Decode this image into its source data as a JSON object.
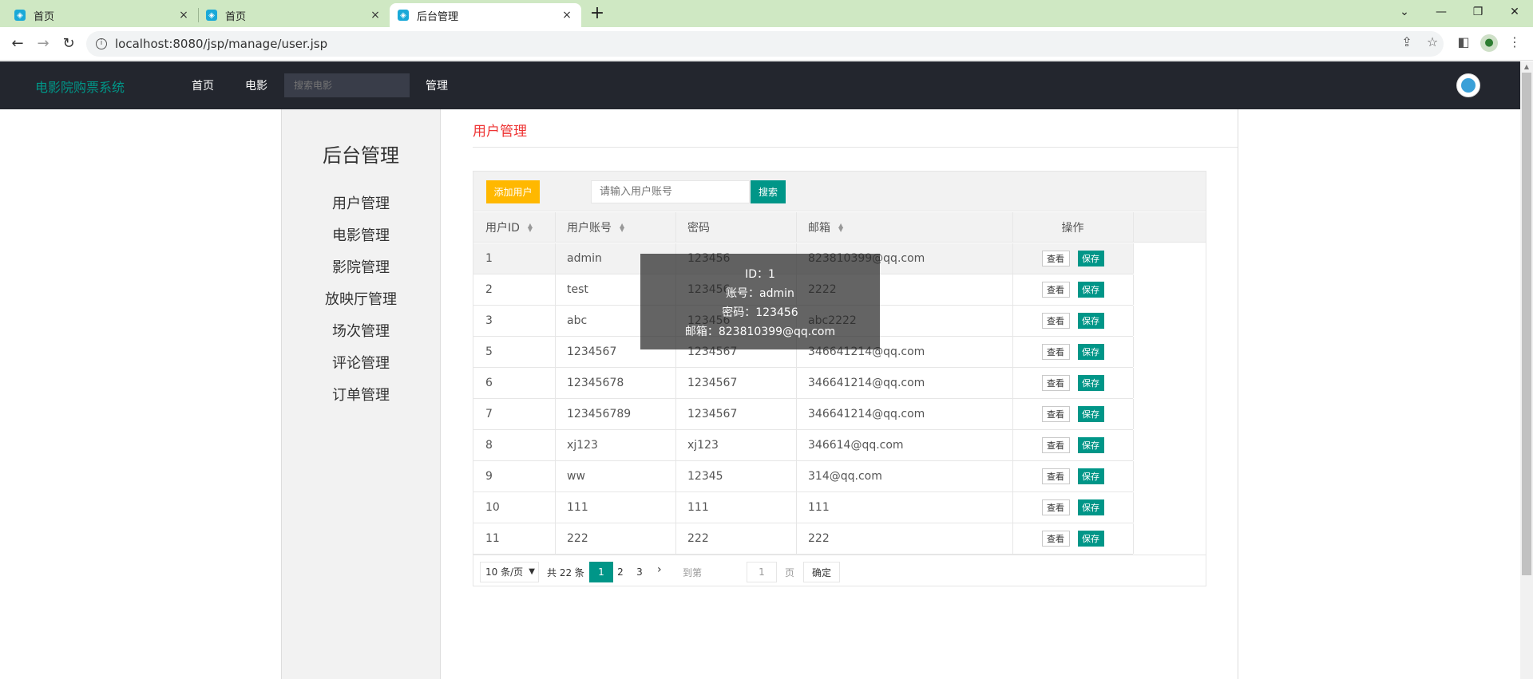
{
  "browser": {
    "tabs": [
      {
        "label": "首页",
        "close": "×"
      },
      {
        "label": "首页",
        "close": "×"
      },
      {
        "label": "后台管理",
        "close": "×"
      }
    ],
    "new_tab": "+",
    "url": "localhost:8080/jsp/manage/user.jsp"
  },
  "header": {
    "logo": "电影院购票系统",
    "nav": [
      "首页",
      "电影",
      "管理"
    ],
    "search_placeholder": "搜索电影"
  },
  "sidebar": {
    "title": "后台管理",
    "items": [
      "用户管理",
      "电影管理",
      "影院管理",
      "放映厅管理",
      "场次管理",
      "评论管理",
      "订单管理"
    ]
  },
  "main": {
    "title": "用户管理",
    "add_button": "添加用户",
    "search_placeholder": "请输入用户账号",
    "search_button": "搜索"
  },
  "table": {
    "columns": [
      "用户ID",
      "用户账号",
      "密码",
      "邮箱",
      "操作"
    ],
    "view_label": "查看",
    "save_label": "保存",
    "rows": [
      {
        "id": "1",
        "account": "admin",
        "password": "123456",
        "email": "823810399@qq.com"
      },
      {
        "id": "2",
        "account": "test",
        "password": "123456",
        "email": "2222"
      },
      {
        "id": "3",
        "account": "abc",
        "password": "123456",
        "email": "abc2222"
      },
      {
        "id": "5",
        "account": "1234567",
        "password": "1234567",
        "email": "346641214@qq.com"
      },
      {
        "id": "6",
        "account": "12345678",
        "password": "1234567",
        "email": "346641214@qq.com"
      },
      {
        "id": "7",
        "account": "123456789",
        "password": "1234567",
        "email": "346641214@qq.com"
      },
      {
        "id": "8",
        "account": "xj123",
        "password": "xj123",
        "email": "346614@qq.com"
      },
      {
        "id": "9",
        "account": "ww",
        "password": "12345",
        "email": "314@qq.com"
      },
      {
        "id": "10",
        "account": "111",
        "password": "111",
        "email": "111"
      },
      {
        "id": "11",
        "account": "222",
        "password": "222",
        "email": "222"
      }
    ]
  },
  "pager": {
    "page_size": "10 条/页",
    "total": "共 22 条",
    "pages": [
      "1",
      "2",
      "3"
    ],
    "current": "1",
    "goto_label": "到第",
    "goto_value": "1",
    "page_unit": "页",
    "confirm": "确定"
  },
  "tooltip": {
    "lines": [
      "ID：1",
      "账号：admin",
      "密码：123456",
      "邮箱：823810399@qq.com"
    ]
  }
}
